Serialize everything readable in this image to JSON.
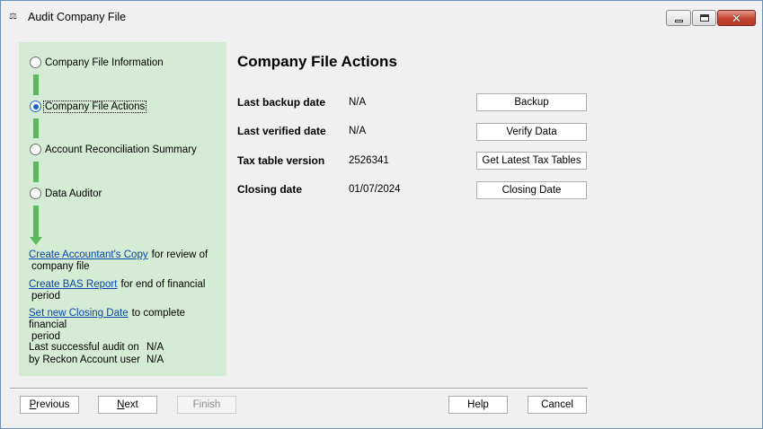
{
  "window": {
    "title": "Audit Company File",
    "icon": "reckon-app-icon"
  },
  "sidebar": {
    "steps": [
      {
        "label": "Company File Information",
        "selected": false
      },
      {
        "label": "Company File Actions",
        "selected": true
      },
      {
        "label": "Account Reconciliation Summary",
        "selected": false
      },
      {
        "label": "Data Auditor",
        "selected": false
      }
    ],
    "links": [
      {
        "link": "Create Accountant's Copy",
        "text": "for review of",
        "cont": "company file"
      },
      {
        "link": "Create BAS Report",
        "text": "for end of financial",
        "cont": "period"
      },
      {
        "link": "Set new Closing Date",
        "text": "to complete financial",
        "cont": "period"
      }
    ],
    "audit": {
      "last_audit_label": "Last successful audit on",
      "last_audit_value": "N/A",
      "by_user_label": "by Reckon Account user",
      "by_user_value": "N/A"
    }
  },
  "main": {
    "title": "Company File Actions",
    "rows": [
      {
        "label": "Last backup date",
        "value": "N/A",
        "button": "Backup"
      },
      {
        "label": "Last verified date",
        "value": "N/A",
        "button": "Verify Data"
      },
      {
        "label": "Tax table version",
        "value": "2526341",
        "button": "Get Latest Tax Tables"
      },
      {
        "label": "Closing date",
        "value": "01/07/2024",
        "button": "Closing Date"
      }
    ]
  },
  "footer": {
    "previous_mn": "P",
    "previous_rest": "revious",
    "next_mn": "N",
    "next_rest": "ext",
    "finish": "Finish",
    "help": "Help",
    "cancel": "Cancel"
  },
  "colors": {
    "sidebar_bg": "#d4ecd4",
    "connector": "#5cb85c",
    "link": "#0645ad",
    "radio_selected": "#1c63c6"
  }
}
